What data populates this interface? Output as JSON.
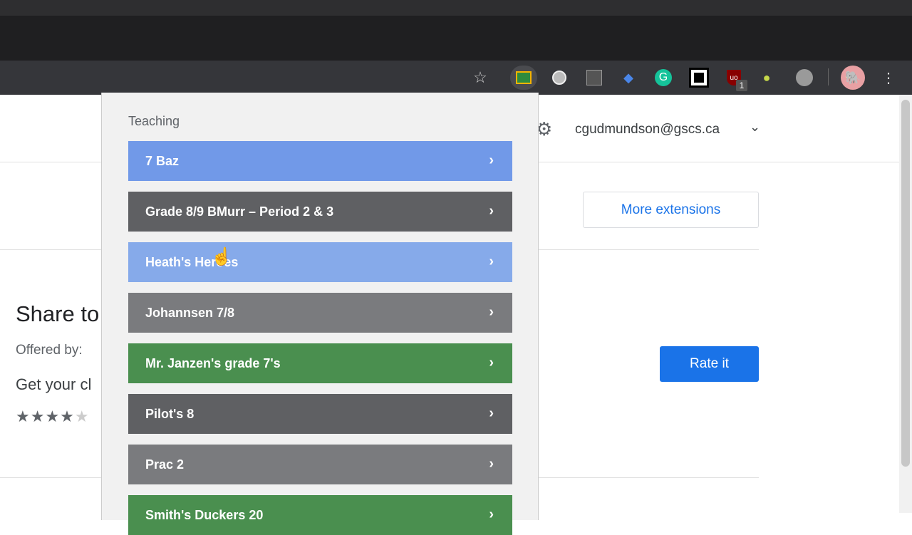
{
  "account": {
    "email": "cgudmundson@gscs.ca"
  },
  "page": {
    "title": "Share to",
    "offered_by": "Offered by:",
    "description": "Get your cl",
    "rating": 4,
    "more_extensions": "More extensions",
    "rate_it": "Rate it"
  },
  "toolbar": {
    "badge_count": "1",
    "icons": [
      "star-icon",
      "google-classroom-icon",
      "extension-circle-icon",
      "extension-globe-icon",
      "extension-cap-icon",
      "grammarly-icon",
      "extension-square-icon",
      "ublock-icon",
      "pear-deck-icon",
      "extension-chart-icon",
      "profile-avatar",
      "menu-icon"
    ]
  },
  "popup": {
    "heading": "Teaching",
    "classes": [
      {
        "label": "7 Baz",
        "color": "#7199e8"
      },
      {
        "label": "Grade 8/9 BMurr – Period 2 & 3",
        "color": "#5f6063"
      },
      {
        "label": "Heath's Heroes",
        "color": "#86aaea"
      },
      {
        "label": "Johannsen 7/8",
        "color": "#7a7b7e"
      },
      {
        "label": "Mr. Janzen's grade 7's",
        "color": "#4a8f4f"
      },
      {
        "label": "Pilot's 8",
        "color": "#5f6063"
      },
      {
        "label": "Prac 2",
        "color": "#7a7b7e"
      },
      {
        "label": "Smith's Duckers 20",
        "color": "#4a8f4f"
      }
    ]
  }
}
